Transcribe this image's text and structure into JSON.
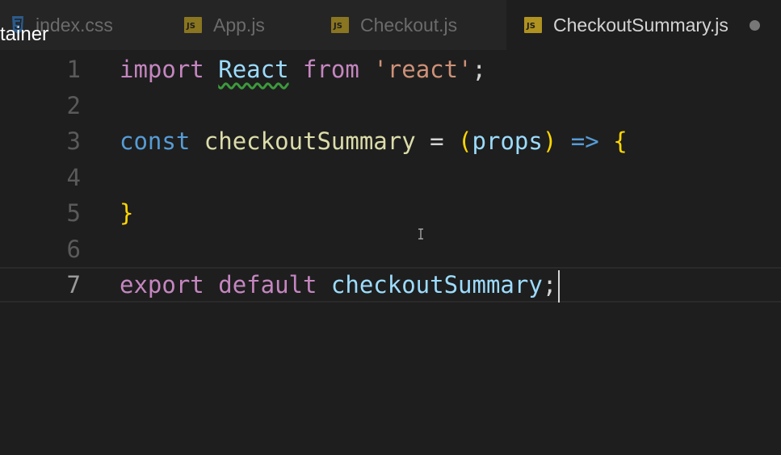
{
  "tabs": [
    {
      "label": "index.css",
      "icon": "css-icon",
      "active": false
    },
    {
      "label": "App.js",
      "icon": "js-icon",
      "active": false
    },
    {
      "label": "Checkout.js",
      "icon": "js-icon",
      "active": false
    },
    {
      "label": "CheckoutSummary.js",
      "icon": "js-icon",
      "active": true,
      "dirty": true
    }
  ],
  "js_icon_text": "JS",
  "overlay_text": "tainer",
  "editor": {
    "lines": [
      {
        "number": "1",
        "tokens": [
          {
            "t": "import",
            "c": "kw"
          },
          {
            "t": " ",
            "c": "punc"
          },
          {
            "t": "React",
            "c": "ident",
            "squiggle": true
          },
          {
            "t": " ",
            "c": "punc"
          },
          {
            "t": "from",
            "c": "kw"
          },
          {
            "t": " ",
            "c": "punc"
          },
          {
            "t": "'react'",
            "c": "str"
          },
          {
            "t": ";",
            "c": "punc"
          }
        ]
      },
      {
        "number": "2",
        "tokens": []
      },
      {
        "number": "3",
        "tokens": [
          {
            "t": "const",
            "c": "kw-blue"
          },
          {
            "t": " ",
            "c": "punc"
          },
          {
            "t": "checkoutSummary",
            "c": "fn"
          },
          {
            "t": " = ",
            "c": "punc"
          },
          {
            "t": "(",
            "c": "brace"
          },
          {
            "t": "props",
            "c": "ident"
          },
          {
            "t": ")",
            "c": "brace"
          },
          {
            "t": " ",
            "c": "punc"
          },
          {
            "t": "=>",
            "c": "kw-blue"
          },
          {
            "t": " ",
            "c": "punc"
          },
          {
            "t": "{",
            "c": "brace"
          }
        ]
      },
      {
        "number": "4",
        "tokens": []
      },
      {
        "number": "5",
        "tokens": [
          {
            "t": "}",
            "c": "brace"
          }
        ]
      },
      {
        "number": "6",
        "tokens": []
      },
      {
        "number": "7",
        "current": true,
        "tokens": [
          {
            "t": "export",
            "c": "kw"
          },
          {
            "t": " ",
            "c": "punc"
          },
          {
            "t": "default",
            "c": "kw"
          },
          {
            "t": " ",
            "c": "punc"
          },
          {
            "t": "checkoutSummary",
            "c": "ident"
          },
          {
            "t": ";",
            "c": "punc"
          }
        ]
      }
    ]
  },
  "colors": {
    "background": "#1e1e1e",
    "keyword": "#c586c0",
    "keyword_blue": "#569cd6",
    "identifier": "#9cdcfe",
    "function": "#dcdcaa",
    "string": "#ce9178",
    "bracket": "#ffd700"
  }
}
